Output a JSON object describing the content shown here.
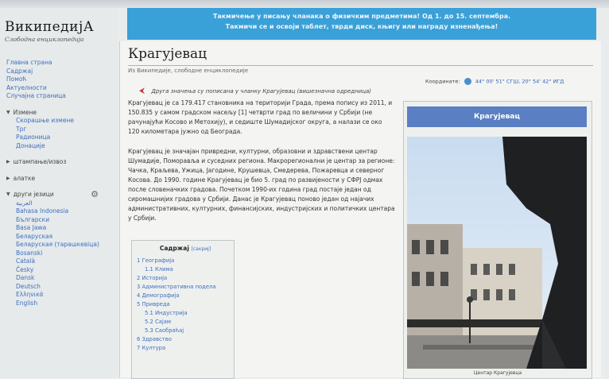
{
  "logo": {
    "title": "ВикипедијА",
    "subtitle": "Слободна енциклопедија"
  },
  "nav": {
    "main_items": [
      "Главна страна",
      "Садржај",
      "Помоћ",
      "Актуелности",
      "Случајна страница"
    ],
    "sections": [
      {
        "label": "Измене",
        "items": [
          "Скорашње измене",
          "Трг",
          "Радионица",
          "Донације"
        ]
      },
      {
        "label": "штампање/извоз",
        "items": []
      },
      {
        "label": "алатке",
        "items": []
      },
      {
        "label": "други језици",
        "items": [
          "العربية",
          "Bahasa Indonesia",
          "Български",
          "Basa Jawa",
          "Беларуская",
          "Беларуская (тарашкевіца)",
          "Bosanski",
          "Català",
          "Česky",
          "Dansk",
          "Deutsch",
          "Ελληνικά",
          "English"
        ]
      }
    ]
  },
  "banner": {
    "line1": "Такмичење у писању чланака о физичким предметима! Од 1. до 15. септембра.",
    "line2": "Такмичи се и освоји таблет, тврди диск, књигу или награду изненађења!"
  },
  "article": {
    "title": "Крагујевац",
    "from": "Из Википедије, слободне енциклопедије",
    "disambig": "Друга значења су пописана у чланку Крагујевац (вишезначна одредница)",
    "coords_label": "Координате:",
    "coords_value": "44° 00' 51\" СГШ, 20° 54' 42\" ИГД",
    "para1": "Крагујевац је са 179.417 становника на територији Града, према попису из 2011, и 150.835 у самом градском насељу [1] четврти град по величини у Србији (не рачунајући Косово и Метохију), и седиште Шумадијског округа, а налази се око 120 километара јужно од Београда.",
    "para2": "Крагујевац је значајан привредни, културни, образовни и здравствени центар Шумадије, Поморавља и суседних региона. Макрорегионални је центар за регионе: Чачка, Краљева, Ужица, Јагодине, Крушевца, Смедерева, Пожаревца и северног Косова. До 1990. године Крагујевац је био 5. град по развијености у СФРЈ одмах после словеначких градова. Почетком 1990-их година град постаје један од сиромашнијих градова у Србији. Данас је Крагујевац поново један од најачих административних, културних, финансијских, индустријских и политичких центара у Србији."
  },
  "toc": {
    "title": "Садржај",
    "toggle": "[сакриј]",
    "items": [
      {
        "label": "1 Географија",
        "level": 1
      },
      {
        "label": "1.1 Клима",
        "level": 2
      },
      {
        "label": "2 Историја",
        "level": 1
      },
      {
        "label": "3 Административна подела",
        "level": 1
      },
      {
        "label": "4 Демографија",
        "level": 1
      },
      {
        "label": "5 Привреда",
        "level": 1
      },
      {
        "label": "5.1 Индустрија",
        "level": 2
      },
      {
        "label": "5.2 Сајам",
        "level": 2
      },
      {
        "label": "5.3 Саобраћај",
        "level": 2
      },
      {
        "label": "6 Здравство",
        "level": 1
      },
      {
        "label": "7 Култура",
        "level": 1
      }
    ]
  },
  "infobox": {
    "title": "Крагујевац",
    "caption": "Центар Крагујевца"
  },
  "colors": {
    "banner": "#3aa0d8",
    "infobox_header": "#5a7fc2",
    "link": "#3f6fc0"
  }
}
